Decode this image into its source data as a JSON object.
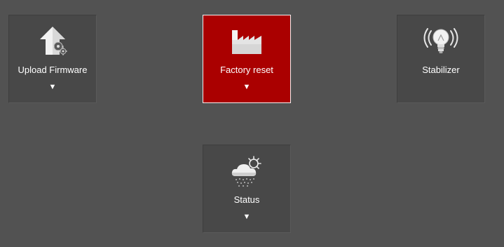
{
  "tiles": [
    {
      "label": "Upload Firmware",
      "icon": "upload-firmware-icon",
      "caret": "▼",
      "active": false
    },
    {
      "label": "Factory reset",
      "icon": "factory-icon",
      "caret": "▼",
      "active": true
    },
    {
      "label": "Stabilizer",
      "icon": "lightbulb-icon",
      "active": false
    },
    {
      "label": "Status",
      "icon": "weather-status-icon",
      "caret": "▼",
      "active": false
    }
  ],
  "colors": {
    "background": "#525252",
    "tile": "#484848",
    "active_tile": "#aa0000",
    "text": "#ffffff"
  }
}
